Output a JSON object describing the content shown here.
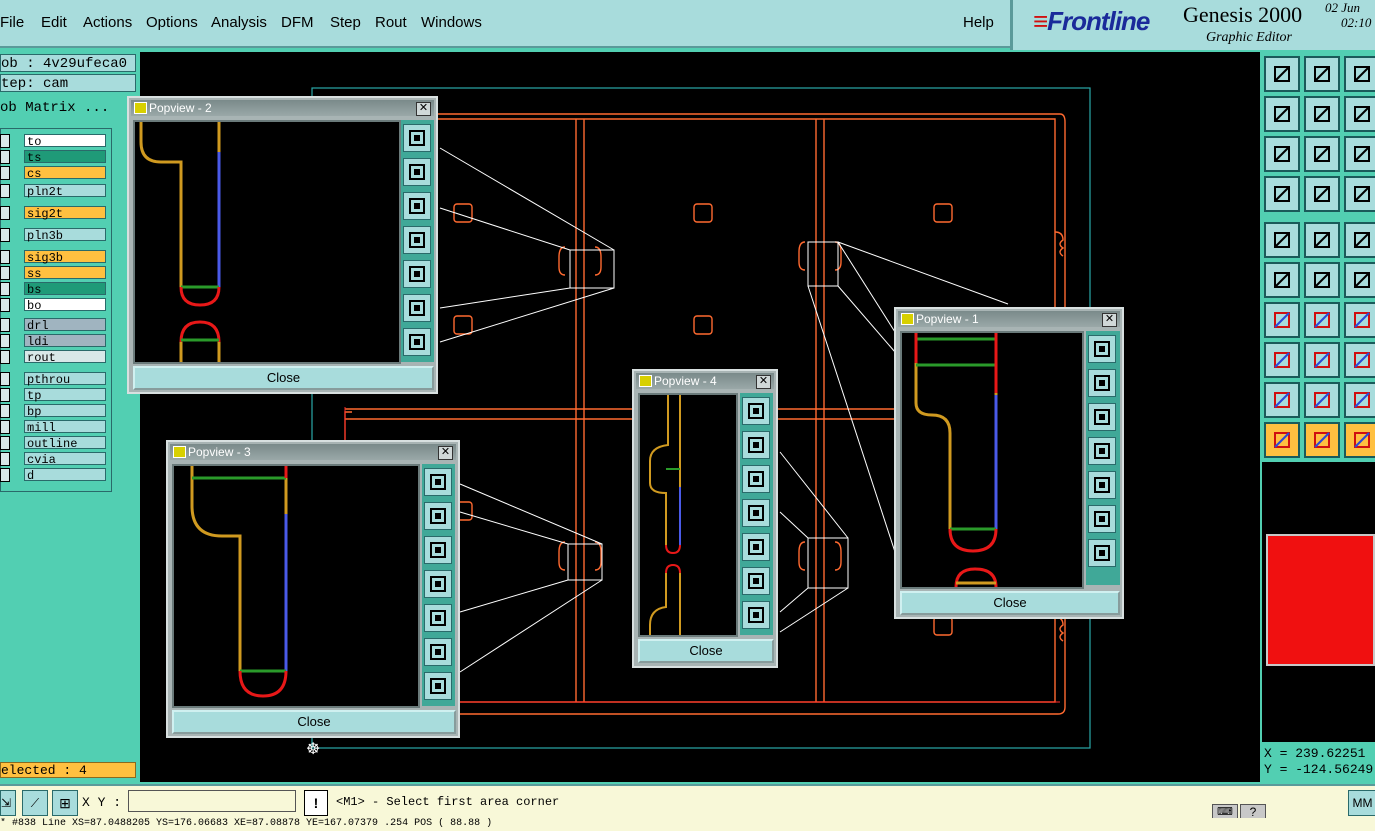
{
  "menubar": {
    "items": [
      "File",
      "Edit",
      "Actions",
      "Options",
      "Analysis",
      "DFM",
      "Step",
      "Rout",
      "Windows"
    ],
    "help": "Help"
  },
  "brand": {
    "logo": "Frontline",
    "product": "Genesis 2000",
    "subtitle": "Graphic Editor",
    "date": "02 Jun",
    "time": "02:10"
  },
  "job": {
    "job_label": "ob : 4v29ufeca0",
    "step_label": "tep: cam",
    "matrix_title": "ob Matrix ..."
  },
  "layers": [
    {
      "name": "to",
      "color": "#ffffff"
    },
    {
      "name": "ts",
      "color": "#1f9a78"
    },
    {
      "name": "cs",
      "color": "#ffc040"
    },
    {
      "name": "pln2t",
      "color": "#a8dcdc"
    },
    {
      "name": "sig2t",
      "color": "#ffc040"
    },
    {
      "name": "pln3b",
      "color": "#a8dcdc"
    },
    {
      "name": "sig3b",
      "color": "#ffc040"
    },
    {
      "name": "ss",
      "color": "#ffc040"
    },
    {
      "name": "bs",
      "color": "#1f9a78"
    },
    {
      "name": "bo",
      "color": "#ffffff"
    },
    {
      "name": "drl",
      "color": "#a0b4c0"
    },
    {
      "name": "ldi",
      "color": "#a0b4c0"
    },
    {
      "name": "rout",
      "color": "#d8e8e8"
    },
    {
      "name": "pthrou",
      "color": "#a8dcdc"
    },
    {
      "name": "tp",
      "color": "#a8dcdc"
    },
    {
      "name": "bp",
      "color": "#a8dcdc"
    },
    {
      "name": "mill",
      "color": "#a8dcdc"
    },
    {
      "name": "outline",
      "color": "#a8dcdc"
    },
    {
      "name": "cvia",
      "color": "#a8dcdc"
    },
    {
      "name": "d",
      "color": "#a8dcdc"
    }
  ],
  "selected": "elected : 4",
  "popviews": [
    {
      "title": "Popview - 2",
      "close": "Close"
    },
    {
      "title": "Popview - 3",
      "close": "Close"
    },
    {
      "title": "Popview - 4",
      "close": "Close"
    },
    {
      "title": "Popview - 1",
      "close": "Close"
    }
  ],
  "coords": {
    "x": "X = 239.62251",
    "y": "Y = -124.56249"
  },
  "bottombar": {
    "xy_label": "X Y :",
    "xy_value": "",
    "prompt": "<M1> - Select first area corner",
    "units": "MM"
  },
  "statusline": "* #838 Line XS=87.0488205 YS=176.06683 XE=87.08878 YE=167.07379 .254 POS ( 88.88 )"
}
